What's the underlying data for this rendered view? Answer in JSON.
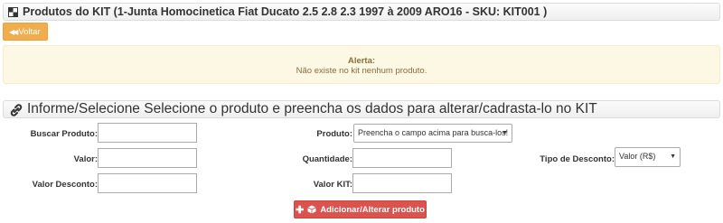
{
  "header": {
    "title": "Produtos do KIT (1-Junta Homocinetica Fiat Ducato 2.5 2.8 2.3 1997 à 2009 ARO16 - SKU: KIT001 )"
  },
  "actions": {
    "voltar_label": "Voltar"
  },
  "alert": {
    "title": "Alerta:",
    "message": "Não existe no kit nenhum produto."
  },
  "form": {
    "title": "Informe/Selecione Selecione o produto e preencha os dados para alterar/cadrasta-lo no KIT",
    "buscar_produto_label": "Buscar Produto:",
    "buscar_produto_value": "",
    "produto_label": "Produto:",
    "produto_selected": "Preencha o campo acima para busca-los!",
    "valor_label": "Valor:",
    "valor_value": "",
    "quantidade_label": "Quantidade:",
    "quantidade_value": "",
    "tipo_desconto_label": "Tipo de Desconto:",
    "tipo_desconto_selected": "Valor (R$)",
    "valor_desconto_label": "Valor Desconto:",
    "valor_desconto_value": "",
    "valor_kit_label": "Valor KIT:",
    "valor_kit_value": "",
    "submit_label": "Adicionar/Alterar produto"
  },
  "colors": {
    "warning_button": "#f0ad4e",
    "danger_button": "#d9534f",
    "alert_background": "#fcf8e3",
    "alert_text": "#8a6d3b"
  },
  "icons": {
    "title": "window-icon",
    "voltar": "double-chevron-left-icon",
    "form_title": "link-icon",
    "submit_plus": "plus-icon",
    "submit_cube": "cube-icon"
  }
}
